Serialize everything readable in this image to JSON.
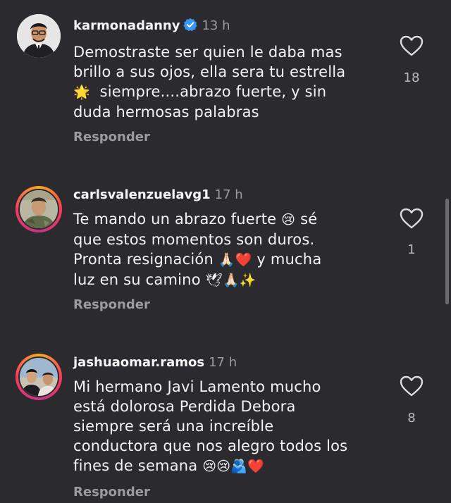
{
  "comments": [
    {
      "username": "karmonadanny",
      "verified": true,
      "time": "13 h",
      "lines": [
        [
          "Demostraste ser quien le daba mas"
        ],
        [
          "brillo a sus ojos, ella sera tu estrella"
        ],
        [
          "🌟",
          "  siempre....abrazo fuerte, y sin"
        ],
        [
          "duda hermosas palabras"
        ]
      ],
      "reply_label": "Responder",
      "likes": "18"
    },
    {
      "username": "carlsvalenzuelavg1",
      "verified": false,
      "time": "17 h",
      "lines": [
        [
          "Te mando un abrazo fuerte ",
          "😢",
          " sé"
        ],
        [
          "que estos momentos son duros."
        ],
        [
          "Pronta resignación ",
          "🙏🏻❤️",
          " y mucha"
        ],
        [
          "luz en su camino ",
          "🕊🙏🏻✨"
        ]
      ],
      "reply_label": "Responder",
      "likes": "1"
    },
    {
      "username": "jashuaomar.ramos",
      "verified": false,
      "time": "17 h",
      "lines": [
        [
          "Mi hermano Javi Lamento mucho"
        ],
        [
          "está dolorosa Perdida Debora"
        ],
        [
          "siempre será una increíble"
        ],
        [
          "conductora que nos alegro todos los"
        ],
        [
          "fines de semana ",
          "😢😢🫂❤️"
        ]
      ],
      "reply_label": "Responder",
      "likes": "8"
    }
  ]
}
